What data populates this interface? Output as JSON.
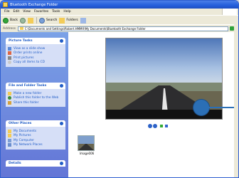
{
  "window": {
    "title": "Bluetooth Exchange Folder"
  },
  "menu": {
    "items": [
      "File",
      "Edit",
      "View",
      "Favorites",
      "Tools",
      "Help"
    ]
  },
  "toolbar": {
    "back": "Back",
    "search": "Search",
    "folders": "Folders"
  },
  "address": {
    "label": "Address",
    "value": "C:\\Documents and Settings\\Robert.HMMX\\My Documents\\Bluetooth Exchange Folder"
  },
  "sidebar": {
    "picture_tasks": {
      "title": "Picture Tasks",
      "items": [
        "View as a slide show",
        "Order prints online",
        "Print pictures",
        "Copy all items to CD"
      ]
    },
    "file_tasks": {
      "title": "File and Folder Tasks",
      "items": [
        "Make a new folder",
        "Publish this folder to the Web",
        "Share this folder"
      ]
    },
    "other_places": {
      "title": "Other Places",
      "items": [
        "My Documents",
        "My Pictures",
        "My Computer",
        "My Network Places"
      ]
    },
    "details": {
      "title": "Details"
    }
  },
  "main": {
    "thumbnail_label": "Image006"
  }
}
